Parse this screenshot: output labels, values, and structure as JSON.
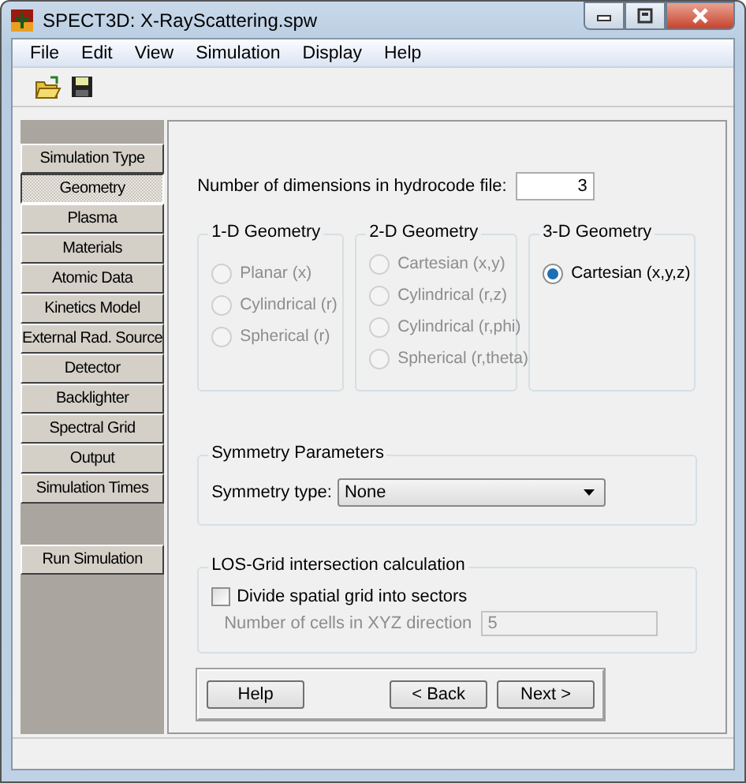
{
  "window": {
    "title": "SPECT3D:  X-RayScattering.spw"
  },
  "menu": [
    "File",
    "Edit",
    "View",
    "Simulation",
    "Display",
    "Help"
  ],
  "sidebar": {
    "items": [
      {
        "label": "Simulation Type",
        "selected": false
      },
      {
        "label": "Geometry",
        "selected": true
      },
      {
        "label": "Plasma",
        "selected": false
      },
      {
        "label": "Materials",
        "selected": false
      },
      {
        "label": "Atomic Data",
        "selected": false
      },
      {
        "label": "Kinetics Model",
        "selected": false
      },
      {
        "label": "External Rad. Source",
        "selected": false
      },
      {
        "label": "Detector",
        "selected": false
      },
      {
        "label": "Backlighter",
        "selected": false
      },
      {
        "label": "Spectral Grid",
        "selected": false
      },
      {
        "label": "Output",
        "selected": false
      },
      {
        "label": "Simulation Times",
        "selected": false
      }
    ],
    "run_button": "Run Simulation"
  },
  "dimensions": {
    "label": "Number of dimensions in hydrocode file:",
    "value": "3"
  },
  "geometry_groups": [
    {
      "title": "1-D Geometry",
      "options": [
        {
          "label": "Planar (x)",
          "selected": false,
          "disabled": true
        },
        {
          "label": "Cylindrical (r)",
          "selected": false,
          "disabled": true
        },
        {
          "label": "Spherical (r)",
          "selected": false,
          "disabled": true
        }
      ]
    },
    {
      "title": "2-D Geometry",
      "options": [
        {
          "label": "Cartesian (x,y)",
          "selected": false,
          "disabled": true
        },
        {
          "label": "Cylindrical (r,z)",
          "selected": false,
          "disabled": true
        },
        {
          "label": "Cylindrical (r,phi)",
          "selected": false,
          "disabled": true
        },
        {
          "label": "Spherical (r,theta)",
          "selected": false,
          "disabled": true
        }
      ]
    },
    {
      "title": "3-D Geometry",
      "options": [
        {
          "label": "Cartesian (x,y,z)",
          "selected": true,
          "disabled": false
        }
      ]
    }
  ],
  "symmetry": {
    "title": "Symmetry Parameters",
    "label": "Symmetry type:",
    "value": "None"
  },
  "los": {
    "title": "LOS-Grid intersection calculation",
    "checkbox": {
      "label": "Divide spatial grid  into sectors",
      "checked": false
    },
    "cells": {
      "label": "Number of cells in XYZ direction",
      "value": "5",
      "disabled": true
    }
  },
  "buttons": [
    "Help",
    "< Back",
    "Next >"
  ]
}
